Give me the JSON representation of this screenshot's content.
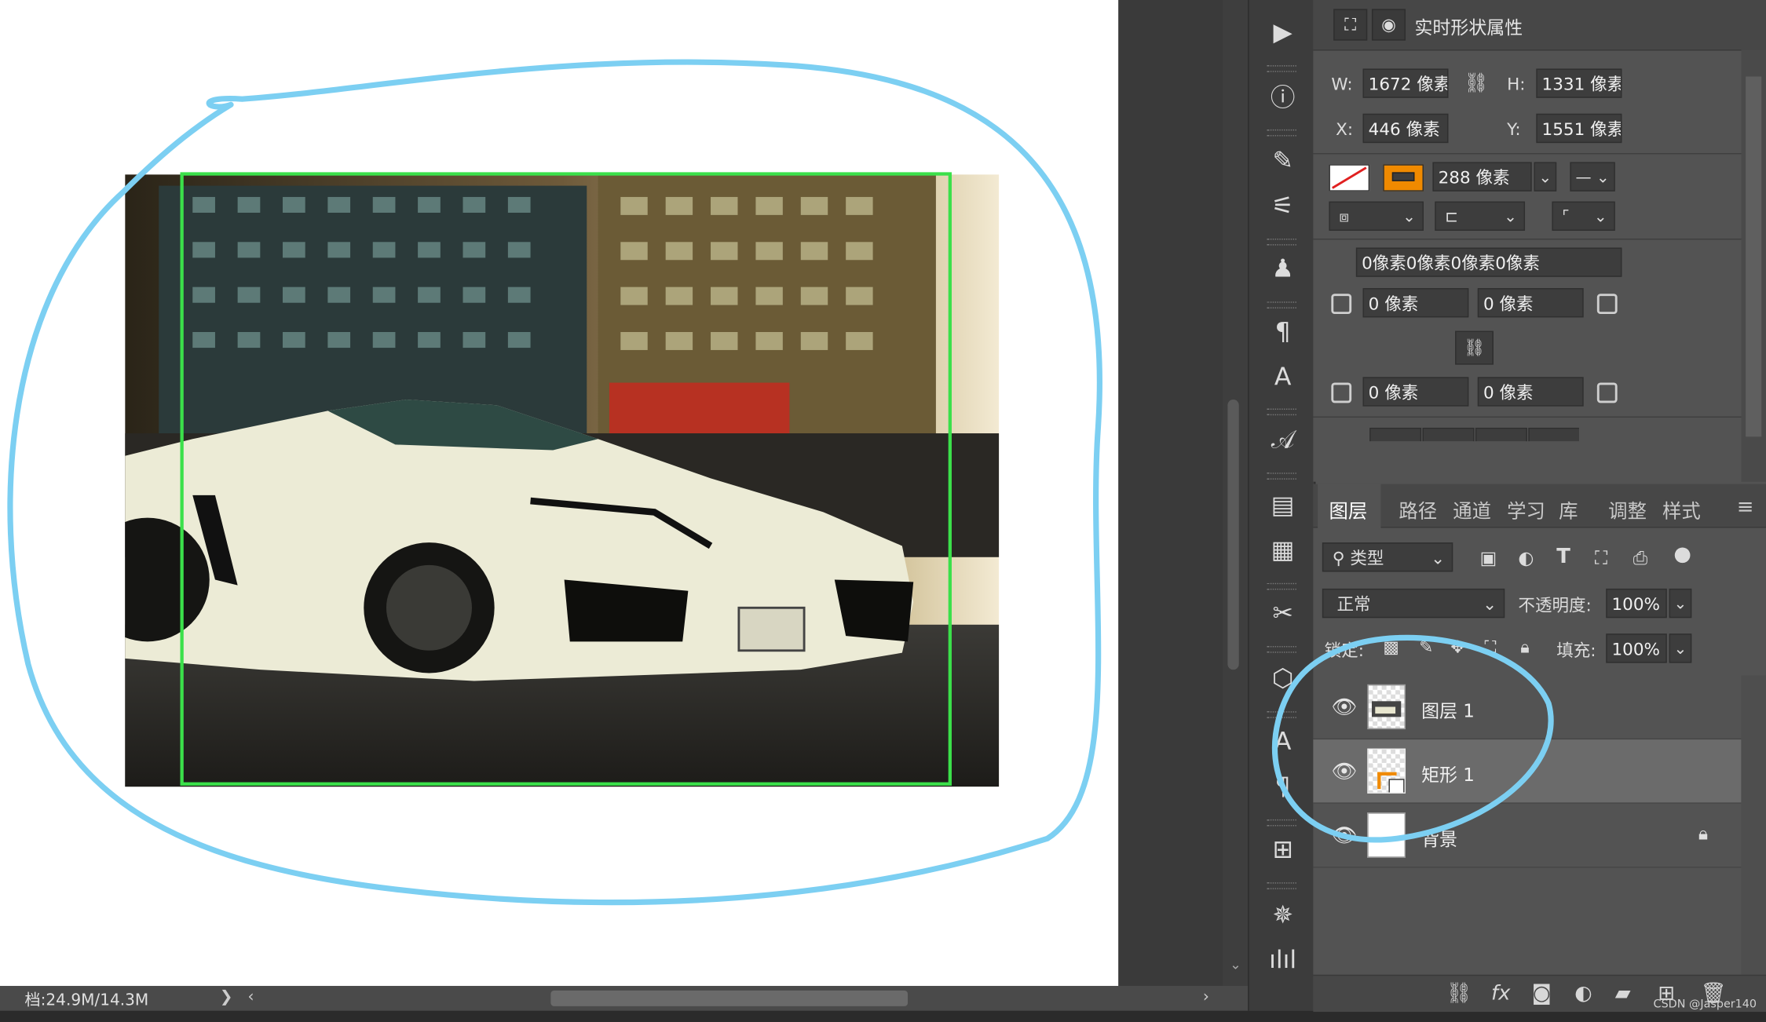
{
  "status": {
    "doc_info": "档:24.9M/14.3M",
    "chevron": "❯"
  },
  "properties": {
    "title": "实时形状属性",
    "w_label": "W:",
    "w_value": "1672 像素",
    "h_label": "H:",
    "h_value": "1331 像素",
    "x_label": "X:",
    "x_value": "446 像素",
    "y_label": "Y:",
    "y_value": "1551 像素",
    "stroke_width": "288 像素",
    "margins": "0像素0像素0像素0像素",
    "corner_tl": "0 像素",
    "corner_tr": "0 像素",
    "corner_bl": "0 像素",
    "corner_br": "0 像素",
    "stroke_color": "#f08a00"
  },
  "layers_panel": {
    "tabs": [
      "图层",
      "路径",
      "通道",
      "学习",
      "库",
      "调整",
      "样式"
    ],
    "filter_label": "类型",
    "blend_mode": "正常",
    "opacity_label": "不透明度:",
    "opacity_value": "100%",
    "lock_label": "锁定:",
    "fill_label": "填充:",
    "fill_value": "100%",
    "layers": [
      {
        "name": "图层 1",
        "selected": false,
        "locked": false
      },
      {
        "name": "矩形 1",
        "selected": true,
        "locked": false
      },
      {
        "name": "背景",
        "selected": false,
        "locked": true
      }
    ]
  },
  "footer": {
    "fx_label": "fx",
    "watermark": "CSDN @Jasper140"
  },
  "colors": {
    "selection_border": "#3be04a",
    "annotation_circle": "#7ccff2",
    "panel_bg": "#535353"
  }
}
